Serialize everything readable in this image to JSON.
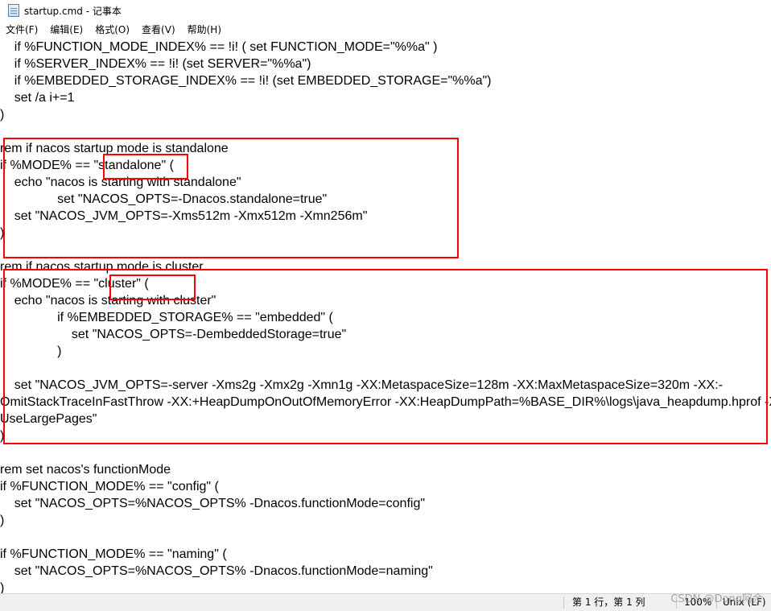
{
  "window": {
    "title": "startup.cmd - 记事本"
  },
  "menu": [
    "文件(F)",
    "编辑(E)",
    "格式(O)",
    "查看(V)",
    "帮助(H)"
  ],
  "lines": [
    "    if %FUNCTION_MODE_INDEX% == !i! ( set FUNCTION_MODE=\"%%a\" )",
    "    if %SERVER_INDEX% == !i! (set SERVER=\"%%a\")",
    "    if %EMBEDDED_STORAGE_INDEX% == !i! (set EMBEDDED_STORAGE=\"%%a\")",
    "    set /a i+=1",
    ")",
    "",
    "rem if nacos startup mode is standalone",
    "if %MODE% == \"standalone\" (",
    "    echo \"nacos is starting with standalone\"",
    "                set \"NACOS_OPTS=-Dnacos.standalone=true\"",
    "    set \"NACOS_JVM_OPTS=-Xms512m -Xmx512m -Xmn256m\"",
    ")",
    "",
    "rem if nacos startup mode is cluster",
    "if %MODE% == \"cluster\" (",
    "    echo \"nacos is starting with cluster\"",
    "                if %EMBEDDED_STORAGE% == \"embedded\" (",
    "                    set \"NACOS_OPTS=-DembeddedStorage=true\"",
    "                )",
    "",
    "    set \"NACOS_JVM_OPTS=-server -Xms2g -Xmx2g -Xmn1g -XX:MetaspaceSize=128m -XX:MaxMetaspaceSize=320m -XX:-",
    "OmitStackTraceInFastThrow -XX:+HeapDumpOnOutOfMemoryError -XX:HeapDumpPath=%BASE_DIR%\\logs\\java_heapdump.hprof -XX:-",
    "UseLargePages\"",
    ")",
    "",
    "rem set nacos's functionMode",
    "if %FUNCTION_MODE% == \"config\" (",
    "    set \"NACOS_OPTS=%NACOS_OPTS% -Dnacos.functionMode=config\"",
    ")",
    "",
    "if %FUNCTION_MODE% == \"naming\" (",
    "    set \"NACOS_OPTS=%NACOS_OPTS% -Dnacos.functionMode=naming\"",
    ")"
  ],
  "status": {
    "position": "第 1 行，第 1 列",
    "zoom": "100%",
    "line_ending": "Unix (LF)"
  },
  "watermark": "CSDN @Dong阿余"
}
